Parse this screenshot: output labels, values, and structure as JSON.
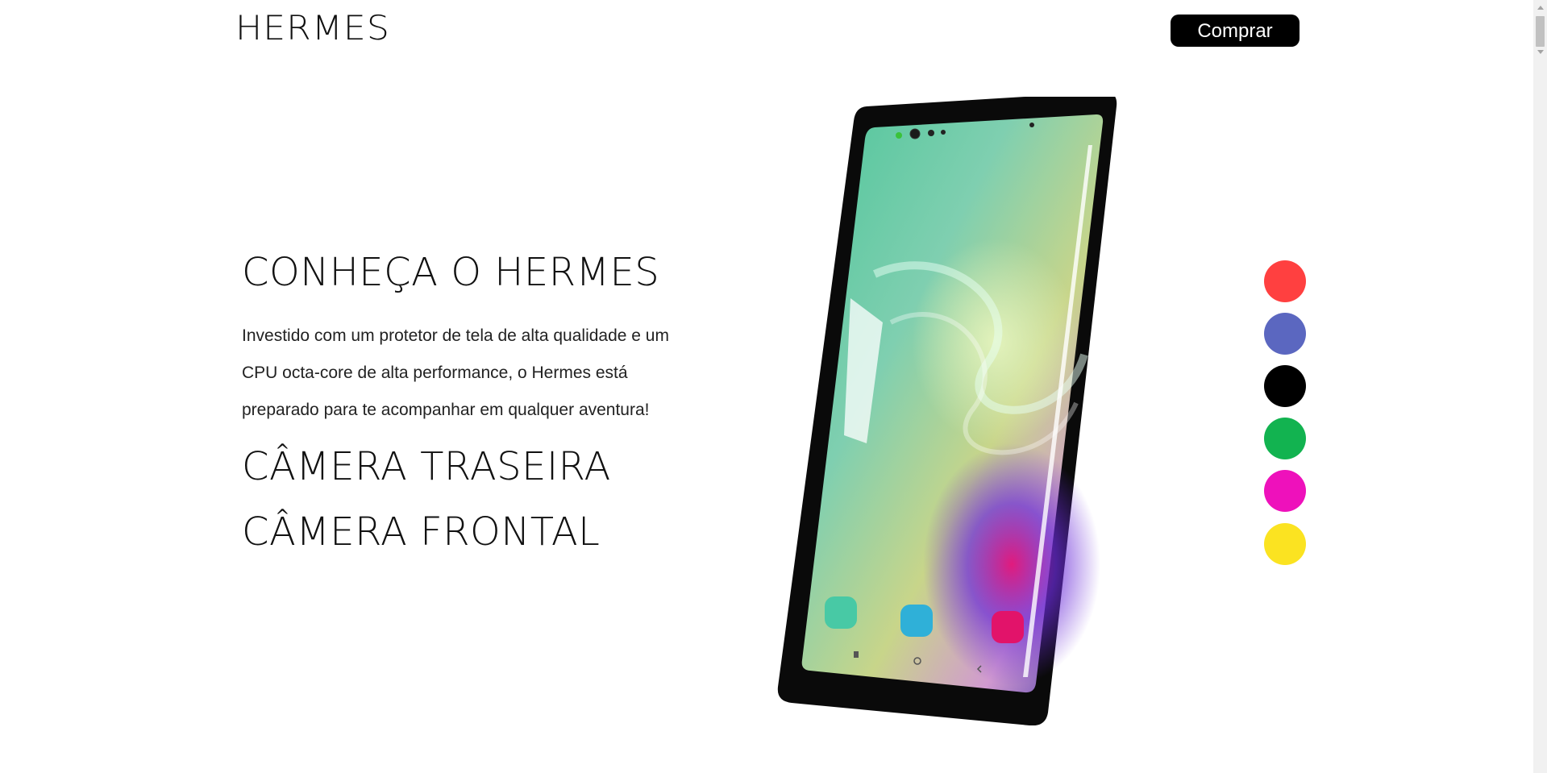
{
  "header": {
    "logo": "HERMES",
    "buy_label": "Comprar"
  },
  "hero": {
    "title": "CONHEÇA O HERMES",
    "description": "Investido com um protetor de tela de alta qualidade e um CPU octa-core de alta performance, o Hermes está preparado para te acompanhar em qualquer aventura!",
    "features": [
      "CÂMERA TRASEIRA",
      "CÂMERA FRONTAL"
    ]
  },
  "color_options": [
    {
      "name": "red",
      "hex": "#ff4040"
    },
    {
      "name": "blue",
      "hex": "#5b67c0"
    },
    {
      "name": "black",
      "hex": "#000000"
    },
    {
      "name": "green",
      "hex": "#12b350"
    },
    {
      "name": "magenta",
      "hex": "#ee11bb"
    },
    {
      "name": "yellow",
      "hex": "#fbe321"
    }
  ],
  "colors": {
    "button_bg": "#000000",
    "button_text": "#ffffff",
    "text": "#111111"
  }
}
